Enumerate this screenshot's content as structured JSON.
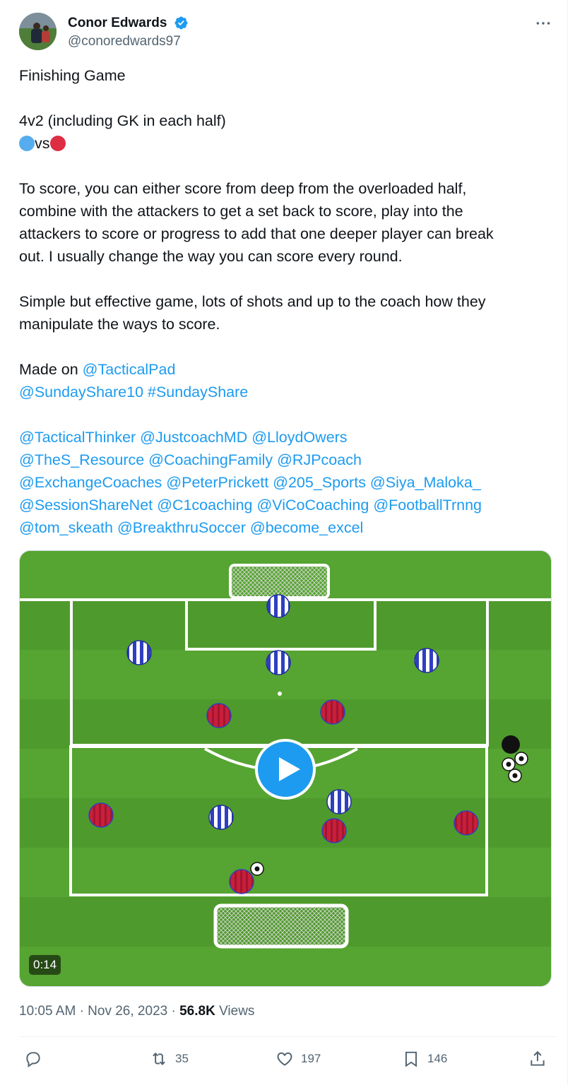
{
  "author": {
    "name": "Conor Edwards",
    "handle": "@conoredwards97",
    "verified": true
  },
  "tweet": {
    "title": "Finishing Game",
    "setup": "4v2 (including GK in each half)",
    "teams_vs": "vs",
    "para1": [
      "To score, you can either score from deep from the overloaded half,",
      "combine with the attackers to get a set back to score, play into the",
      "attackers to score or progress to add that one deeper player can break",
      "out. I usually change the way you can score every round."
    ],
    "para2": [
      "Simple but effective game, lots of shots and up to the coach how they",
      "manipulate the ways to score."
    ],
    "made_on": "Made on",
    "made_on_link": "@TacticalPad",
    "share_line": "@SundayShare10 #SundayShare",
    "mentions": [
      "@TacticalThinker @JustcoachMD @LloydOwers",
      "@TheS_Resource @CoachingFamily @RJPcoach",
      "@ExchangeCoaches @PeterPrickett @205_Sports @Siya_Maloka_",
      "@SessionShareNet @C1coaching @ViCoCoaching @FootballTrnng",
      "@tom_skeath @BreakthruSoccer @become_excel"
    ]
  },
  "video": {
    "duration": "0:14"
  },
  "meta": {
    "time": "10:05 AM",
    "sep1": "·",
    "date": "Nov 26, 2023",
    "sep2": "·",
    "views_count": "56.8K",
    "views_label": "Views"
  },
  "actions": {
    "reposts": "35",
    "likes": "197",
    "bookmarks": "146"
  },
  "colors": {
    "link": "#1d9bf0",
    "verified": "#1d9bf0",
    "muted": "#536471",
    "pitch": "#4e9a2c",
    "team_blue": "#2f3fbf",
    "team_red": "#d8283a"
  },
  "icons": [
    "verified-badge-icon",
    "more-icon",
    "play-icon",
    "reply-icon",
    "repost-icon",
    "like-icon",
    "bookmark-icon",
    "share-icon"
  ]
}
